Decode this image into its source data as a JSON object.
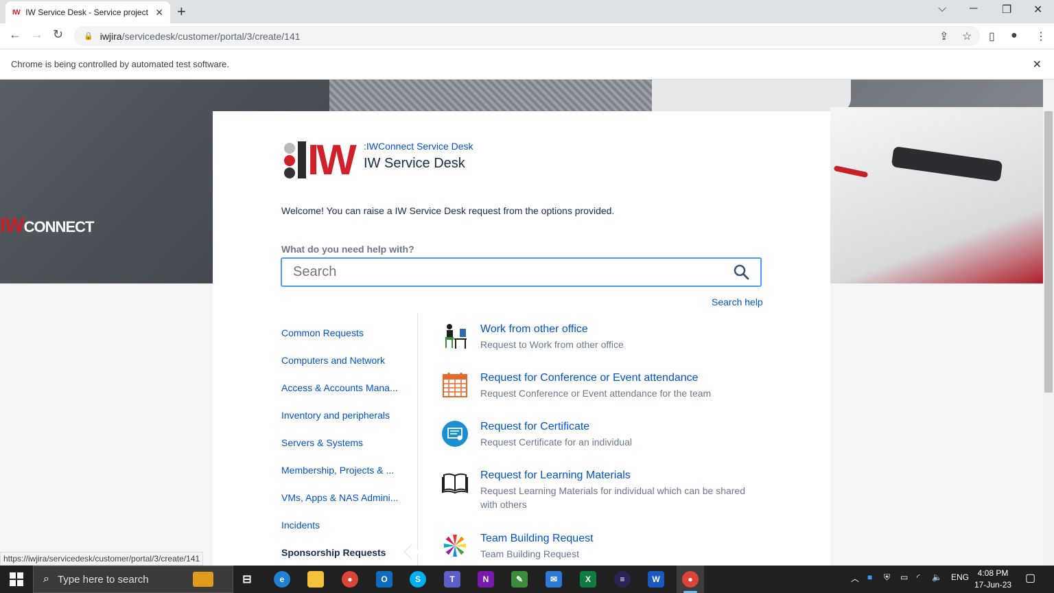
{
  "browser": {
    "tab_title": "IW Service Desk - Service project",
    "tab_favicon": "IW",
    "url_host": "iwjira",
    "url_path": "/servicedesk/customer/portal/3/create/141",
    "infobar_text": "Chrome is being controlled by automated test software.",
    "status_url": "https://iwjira/servicedesk/customer/portal/3/create/141"
  },
  "hero": {
    "logo_w": "W",
    "logo_text": "CONNECT",
    "logo_prefix": "I"
  },
  "portal": {
    "subtitle": ":IWConnect Service Desk",
    "title": "IW Service Desk",
    "logo_text": "IW",
    "welcome": "Welcome! You can raise a IW Service Desk request from the options provided.",
    "help_label": "What do you need help with?",
    "search_placeholder": "Search",
    "search_help": "Search help"
  },
  "categories": [
    {
      "label": "Common Requests"
    },
    {
      "label": "Computers and Network"
    },
    {
      "label": "Access & Accounts Mana..."
    },
    {
      "label": "Inventory and peripherals"
    },
    {
      "label": "Servers & Systems"
    },
    {
      "label": "Membership, Projects & ..."
    },
    {
      "label": "VMs, Apps & NAS Admini..."
    },
    {
      "label": "Incidents"
    },
    {
      "label": "Sponsorship Requests"
    }
  ],
  "requests": [
    {
      "title": "Work from other office",
      "desc": "Request to Work from other office",
      "icon": "desk-worker-icon"
    },
    {
      "title": "Request for Conference or Event attendance",
      "desc": "Request Conference or Event attendance for the team",
      "icon": "calendar-icon"
    },
    {
      "title": "Request for Certificate",
      "desc": "Request Certificate for an individual",
      "icon": "certificate-icon"
    },
    {
      "title": "Request for Learning Materials",
      "desc": "Request Learning Materials for individual which can be shared with others",
      "icon": "book-icon"
    },
    {
      "title": "Team Building Request",
      "desc": "Team Building Request",
      "icon": "team-icon"
    }
  ],
  "taskbar": {
    "search_placeholder": "Type here to search",
    "lang": "ENG",
    "time": "4:08 PM",
    "date": "17-Jun-23"
  },
  "colors": {
    "link": "#0052cc",
    "brand_red": "#d0202a",
    "focus": "#4c9aff"
  }
}
